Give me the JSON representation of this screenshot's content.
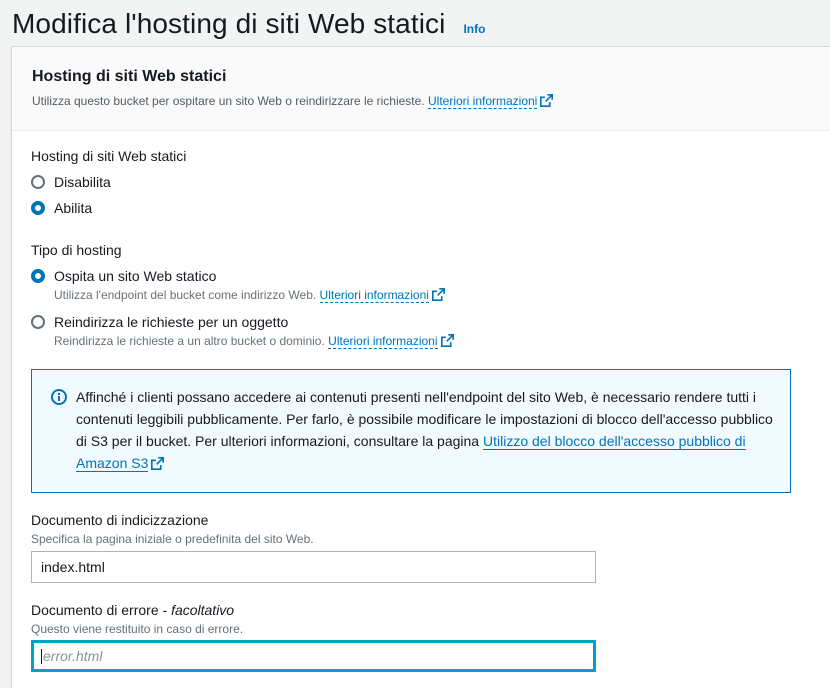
{
  "page": {
    "title": "Modifica l'hosting di siti Web statici",
    "info_label": "Info"
  },
  "panel": {
    "title": "Hosting di siti Web statici",
    "description": "Utilizza questo bucket per ospitare un sito Web o reindirizzare le richieste.",
    "learn_more": "Ulteriori informazioni"
  },
  "hosting": {
    "label": "Hosting di siti Web statici",
    "options": [
      {
        "label": "Disabilita",
        "selected": false
      },
      {
        "label": "Abilita",
        "selected": true
      }
    ]
  },
  "hosting_type": {
    "label": "Tipo di hosting",
    "options": [
      {
        "label": "Ospita un sito Web statico",
        "description": "Utilizza l'endpoint del bucket come indirizzo Web.",
        "link": "Ulteriori informazioni",
        "selected": true
      },
      {
        "label": "Reindirizza le richieste per un oggetto",
        "description": "Reindirizza le richieste a un altro bucket o dominio.",
        "link": "Ulteriori informazioni",
        "selected": false
      }
    ]
  },
  "alert": {
    "text": "Affinché i clienti possano accedere ai contenuti presenti nell'endpoint del sito Web, è necessario rendere tutti i contenuti leggibili pubblicamente. Per farlo, è possibile modificare le impostazioni di blocco dell'accesso pubblico di S3 per il bucket. Per ulteriori informazioni, consultare la pagina ",
    "link": "Utilizzo del blocco dell'accesso pubblico di Amazon S3"
  },
  "index_document": {
    "label": "Documento di indicizzazione",
    "description": "Specifica la pagina iniziale o predefinita del sito Web.",
    "value": "index.html"
  },
  "error_document": {
    "label": "Documento di errore - ",
    "optional": "facoltativo",
    "description": "Questo viene restituito in caso di errore.",
    "placeholder": "error.html",
    "value": ""
  },
  "colors": {
    "link": "#0073bb",
    "focus": "#00a1c9",
    "alert_bg": "#f1faff"
  },
  "icons": [
    "external-link-icon",
    "info-circle-icon"
  ]
}
